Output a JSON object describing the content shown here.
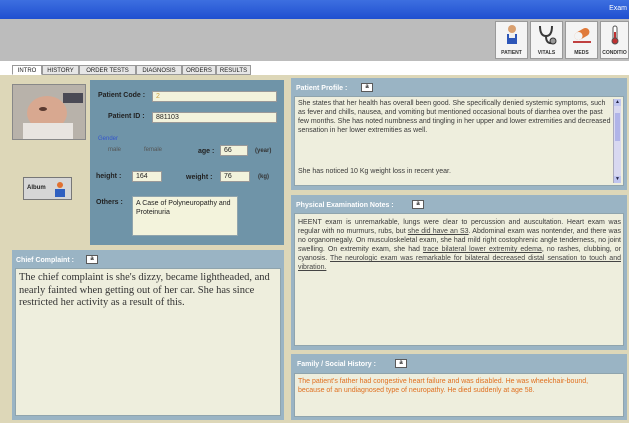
{
  "window": {
    "title": "Exam"
  },
  "toolbar": {
    "buttons": [
      {
        "label": "PATIENT",
        "icon": "patient-icon"
      },
      {
        "label": "VITALS",
        "icon": "stethoscope-icon"
      },
      {
        "label": "MEDS",
        "icon": "meds-icon"
      },
      {
        "label": "CONDITIO",
        "icon": "condition-icon"
      }
    ]
  },
  "tabs": [
    "INTRO",
    "HISTORY",
    "ORDER TESTS",
    "DIAGNOSIS",
    "ORDERS",
    "RESULTS"
  ],
  "patient": {
    "code_label": "Patient Code :",
    "code_value": "2",
    "id_label": "Patient ID :",
    "id_value": "881103",
    "gender_label": "Gender",
    "gender_male": "male",
    "gender_female": "female",
    "age_label": "age :",
    "age_value": "66",
    "age_unit": "(year)",
    "height_label": "height :",
    "height_value": "164",
    "weight_label": "weight :",
    "weight_value": "76",
    "weight_unit": "(kg)",
    "others_label": "Others :",
    "others_value": "A Case of Polyneuropathy and Proteinuria",
    "album_label": "Album"
  },
  "edit_glyph": "a",
  "chief_complaint": {
    "title": "Chief Complaint :",
    "text": "The chief complaint is she's dizzy, became lightheaded, and nearly fainted when getting out of her car. She has since restricted her activity as a result of this."
  },
  "profile": {
    "title": "Patient Profile :",
    "text1": "She states that her health has overall been good. She specifically denied systemic symptoms, such as fever and chills, nausea, and vomiting but mentioned occasional bouts of diarrhea over the past few months. She has noted numbness and tingling in her upper and lower extremities and decreased sensation in her lower extremities as well.",
    "text2": "She has noticed 10 Kg weight loss in recent year."
  },
  "exam": {
    "title": "Physical Examination Notes :",
    "t1": "HEENT exam is unremarkable, lungs were clear to percussion and auscultation. Heart exam was regular with no murmurs, rubs, but ",
    "u1": "she did have an S3",
    "t2": ". Abdominal exam was nontender, and there was no organomegaly. On musculoskeletal exam, she had mild right costophrenic angle tenderness, no joint swelling. On extremity exam, she had ",
    "u2": "trace bilateral lower extremity edema",
    "t3": ", no rashes, clubbing, or cyanosis. ",
    "u3": "The neurologic exam was remarkable for bilateral decreased distal sensation to touch and vibration."
  },
  "family": {
    "title": "Family / Social History :",
    "text": "The patient's father had congestive heart failure and was disabled. He was wheelchair-bound, because of an undiagnosed type of neuropathy. He died suddenly at age 58."
  },
  "colors": {
    "titlebar": "#1f4fd0",
    "panel": "#6f94a8",
    "family_text": "#e07020",
    "gender_label": "#3355cc"
  }
}
